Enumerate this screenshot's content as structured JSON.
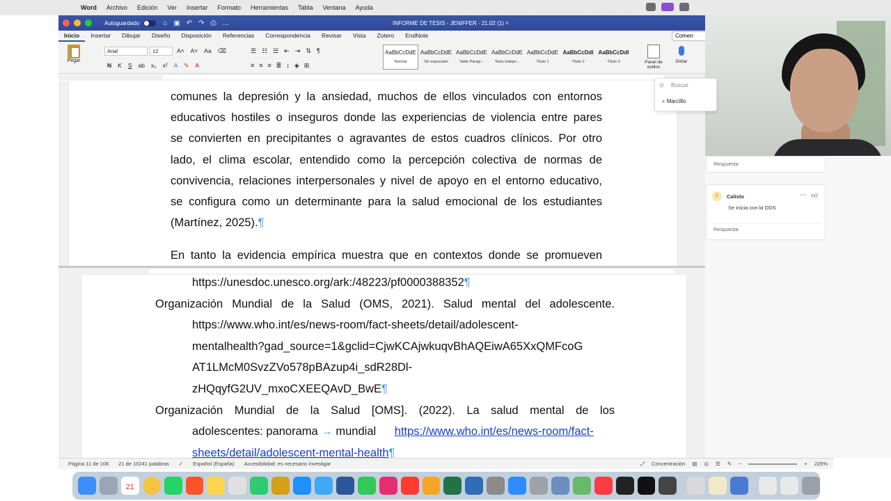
{
  "menubar": {
    "app": "Word",
    "items": [
      "Archivo",
      "Edición",
      "Ver",
      "Insertar",
      "Formato",
      "Herramientas",
      "Tabla",
      "Ventana",
      "Ayuda"
    ]
  },
  "titlebar": {
    "autosave_label": "Autoguardado",
    "document_title": "INFORME DE TESIS - JENIFFER - 21.02 (1) ˅"
  },
  "ribbon_tabs": [
    "Inicio",
    "Insertar",
    "Dibujar",
    "Diseño",
    "Disposición",
    "Referencias",
    "Correspondencia",
    "Revisar",
    "Vista",
    "Zotero",
    "EndNote"
  ],
  "comments_button": "Comen",
  "toolbar": {
    "paste_label": "Pegar",
    "font_name": "Arial",
    "font_size": "12",
    "bold": "N",
    "italic": "K",
    "underline": "S",
    "styles": [
      {
        "sample": "AaBbCcDdE",
        "name": "Normal"
      },
      {
        "sample": "AaBbCcDdE",
        "name": "Sin espaciado"
      },
      {
        "sample": "AaBbCcDdE",
        "name": "Table Paragr..."
      },
      {
        "sample": "AaBbCcDdE",
        "name": "Texto indepe..."
      },
      {
        "sample": "AaBbCcDdE",
        "name": "Título 1"
      },
      {
        "sample": "AaBbCcDdI",
        "name": "Título 2"
      },
      {
        "sample": "AaBbCcDdI",
        "name": "Título 3"
      }
    ],
    "styles_panel_label": "Panel de estilos",
    "dictate_label": "Dictar"
  },
  "document_top": {
    "lines": [
      "comunes la depresión y la ansiedad, muchos de ellos vinculados con entornos",
      "educativos hostiles o inseguros donde las experiencias de violencia entre pares",
      "se convierten en precipitantes o agravantes de estos cuadros clínicos. Por otro",
      "lado, el clima escolar, entendido como la percepción colectiva de normas de",
      "convivencia, relaciones interpersonales y nivel de apoyo en el entorno educativo,",
      "se configura como un determinante para la salud emocional de los estudiantes",
      "(Martínez, 2025)."
    ],
    "next_paragraph": "En tanto la evidencia empírica muestra que en contextos donde se promueven",
    "pilcrow": "¶"
  },
  "document_bottom": {
    "ref0_url": "https://unesdoc.unesco.org/ark:/48223/pf0000388352",
    "ref1_title": "Organización Mundial de la Salud (OMS, 2021). Salud mental del adolescente.",
    "ref1_url_lines": [
      "https://www.who.int/es/news-room/fact-sheets/detail/adolescent-",
      "mentalhealth?gad_source=1&gclid=CjwKCAjwkuqvBhAQEiwA65XxQMFcoG",
      "AT1LMcM0SvzZVo578pBAzup4i_sdR28Dl-",
      "zHQqyfG2UV_mxoCXEEQAvD_BwE"
    ],
    "ref2_title": "Organización Mundial de la Salud [OMS]. (2022). La salud mental de los",
    "ref2_line2_text": "adolescentes: panorama",
    "ref2_tab_arrow": "→",
    "ref2_line2_word": "mundial",
    "ref2_link_part1": "https://www.who.int/es/news-room/fact-",
    "ref2_link_part2": "sheets/detail/adolescent-mental-health"
  },
  "search_popover": {
    "placeholder": "Buscar",
    "value": "Marcillo"
  },
  "comments": [
    {
      "reply_placeholder": "Respuesta"
    },
    {
      "author": "Calixto",
      "initial": "C",
      "text": "Se inicia con la ODS",
      "reply_placeholder": "Respuesta"
    }
  ],
  "statusbar": {
    "page": "Página 11 de 106",
    "words": "21 de 10241 palabras",
    "language": "Español (España)",
    "accessibility": "Accesibilidad: es necesario investigar",
    "focus": "Concentración",
    "zoom": "226%"
  },
  "dock": {
    "calendar_day": "21"
  }
}
